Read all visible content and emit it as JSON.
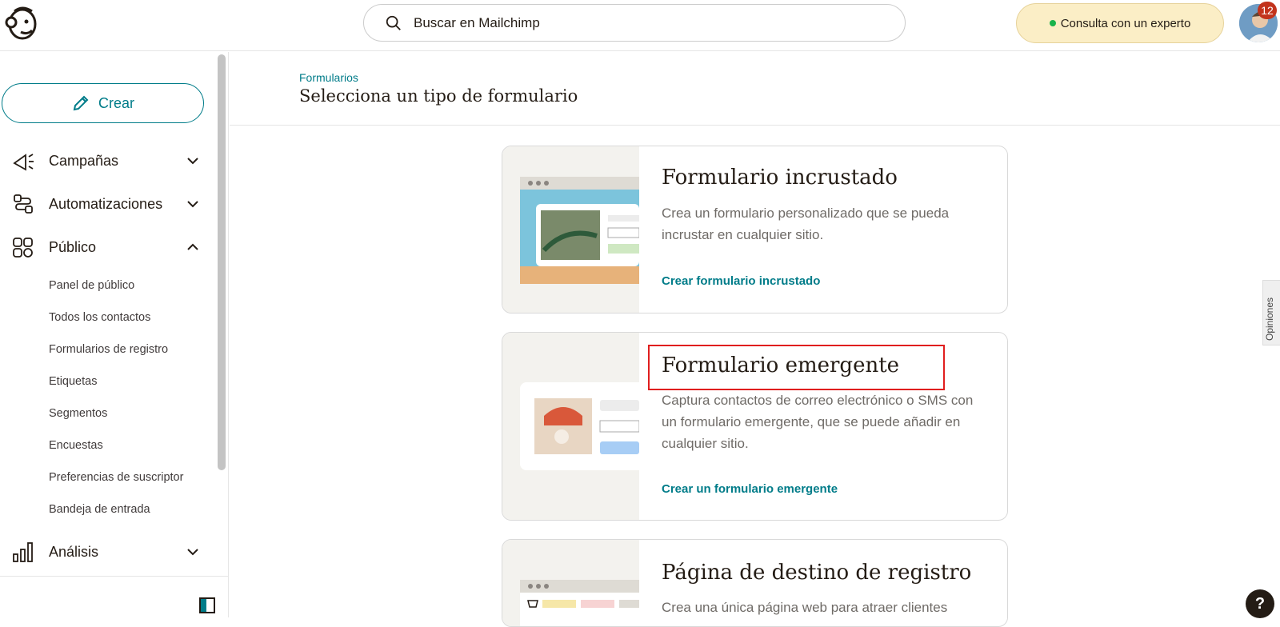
{
  "search": {
    "placeholder": "Buscar en Mailchimp"
  },
  "header": {
    "expert_label": "Consulta con un experto",
    "notification_count": "12"
  },
  "sidebar": {
    "create_label": "Crear",
    "nav": [
      {
        "label": "Campañas",
        "icon": "megaphone-icon"
      },
      {
        "label": "Automatizaciones",
        "icon": "automation-icon"
      },
      {
        "label": "Público",
        "icon": "audience-icon"
      },
      {
        "label": "Análisis",
        "icon": "analytics-icon"
      }
    ],
    "sub_items": [
      "Panel de público",
      "Todos los contactos",
      "Formularios de registro",
      "Etiquetas",
      "Segmentos",
      "Encuestas",
      "Preferencias de suscriptor",
      "Bandeja de entrada"
    ]
  },
  "main": {
    "breadcrumb": "Formularios",
    "title": "Selecciona un tipo de formulario",
    "cards": [
      {
        "title": "Formulario incrustado",
        "desc": "Crea un formulario personalizado que se pueda incrustar en cualquier sitio.",
        "link": "Crear formulario incrustado"
      },
      {
        "title": "Formulario emergente",
        "desc": "Captura contactos de correo electrónico o SMS con un formulario emergente, que se puede añadir en cualquier sitio.",
        "link": "Crear un formulario emergente"
      },
      {
        "title": "Página de destino de registro",
        "desc": "Crea una única página web para atraer clientes"
      }
    ]
  },
  "feedback_label": "Opiniones",
  "help_label": "?",
  "colors": {
    "accent": "#007c89",
    "expert_bg": "#fbeec6",
    "highlight": "#e01e1e"
  }
}
